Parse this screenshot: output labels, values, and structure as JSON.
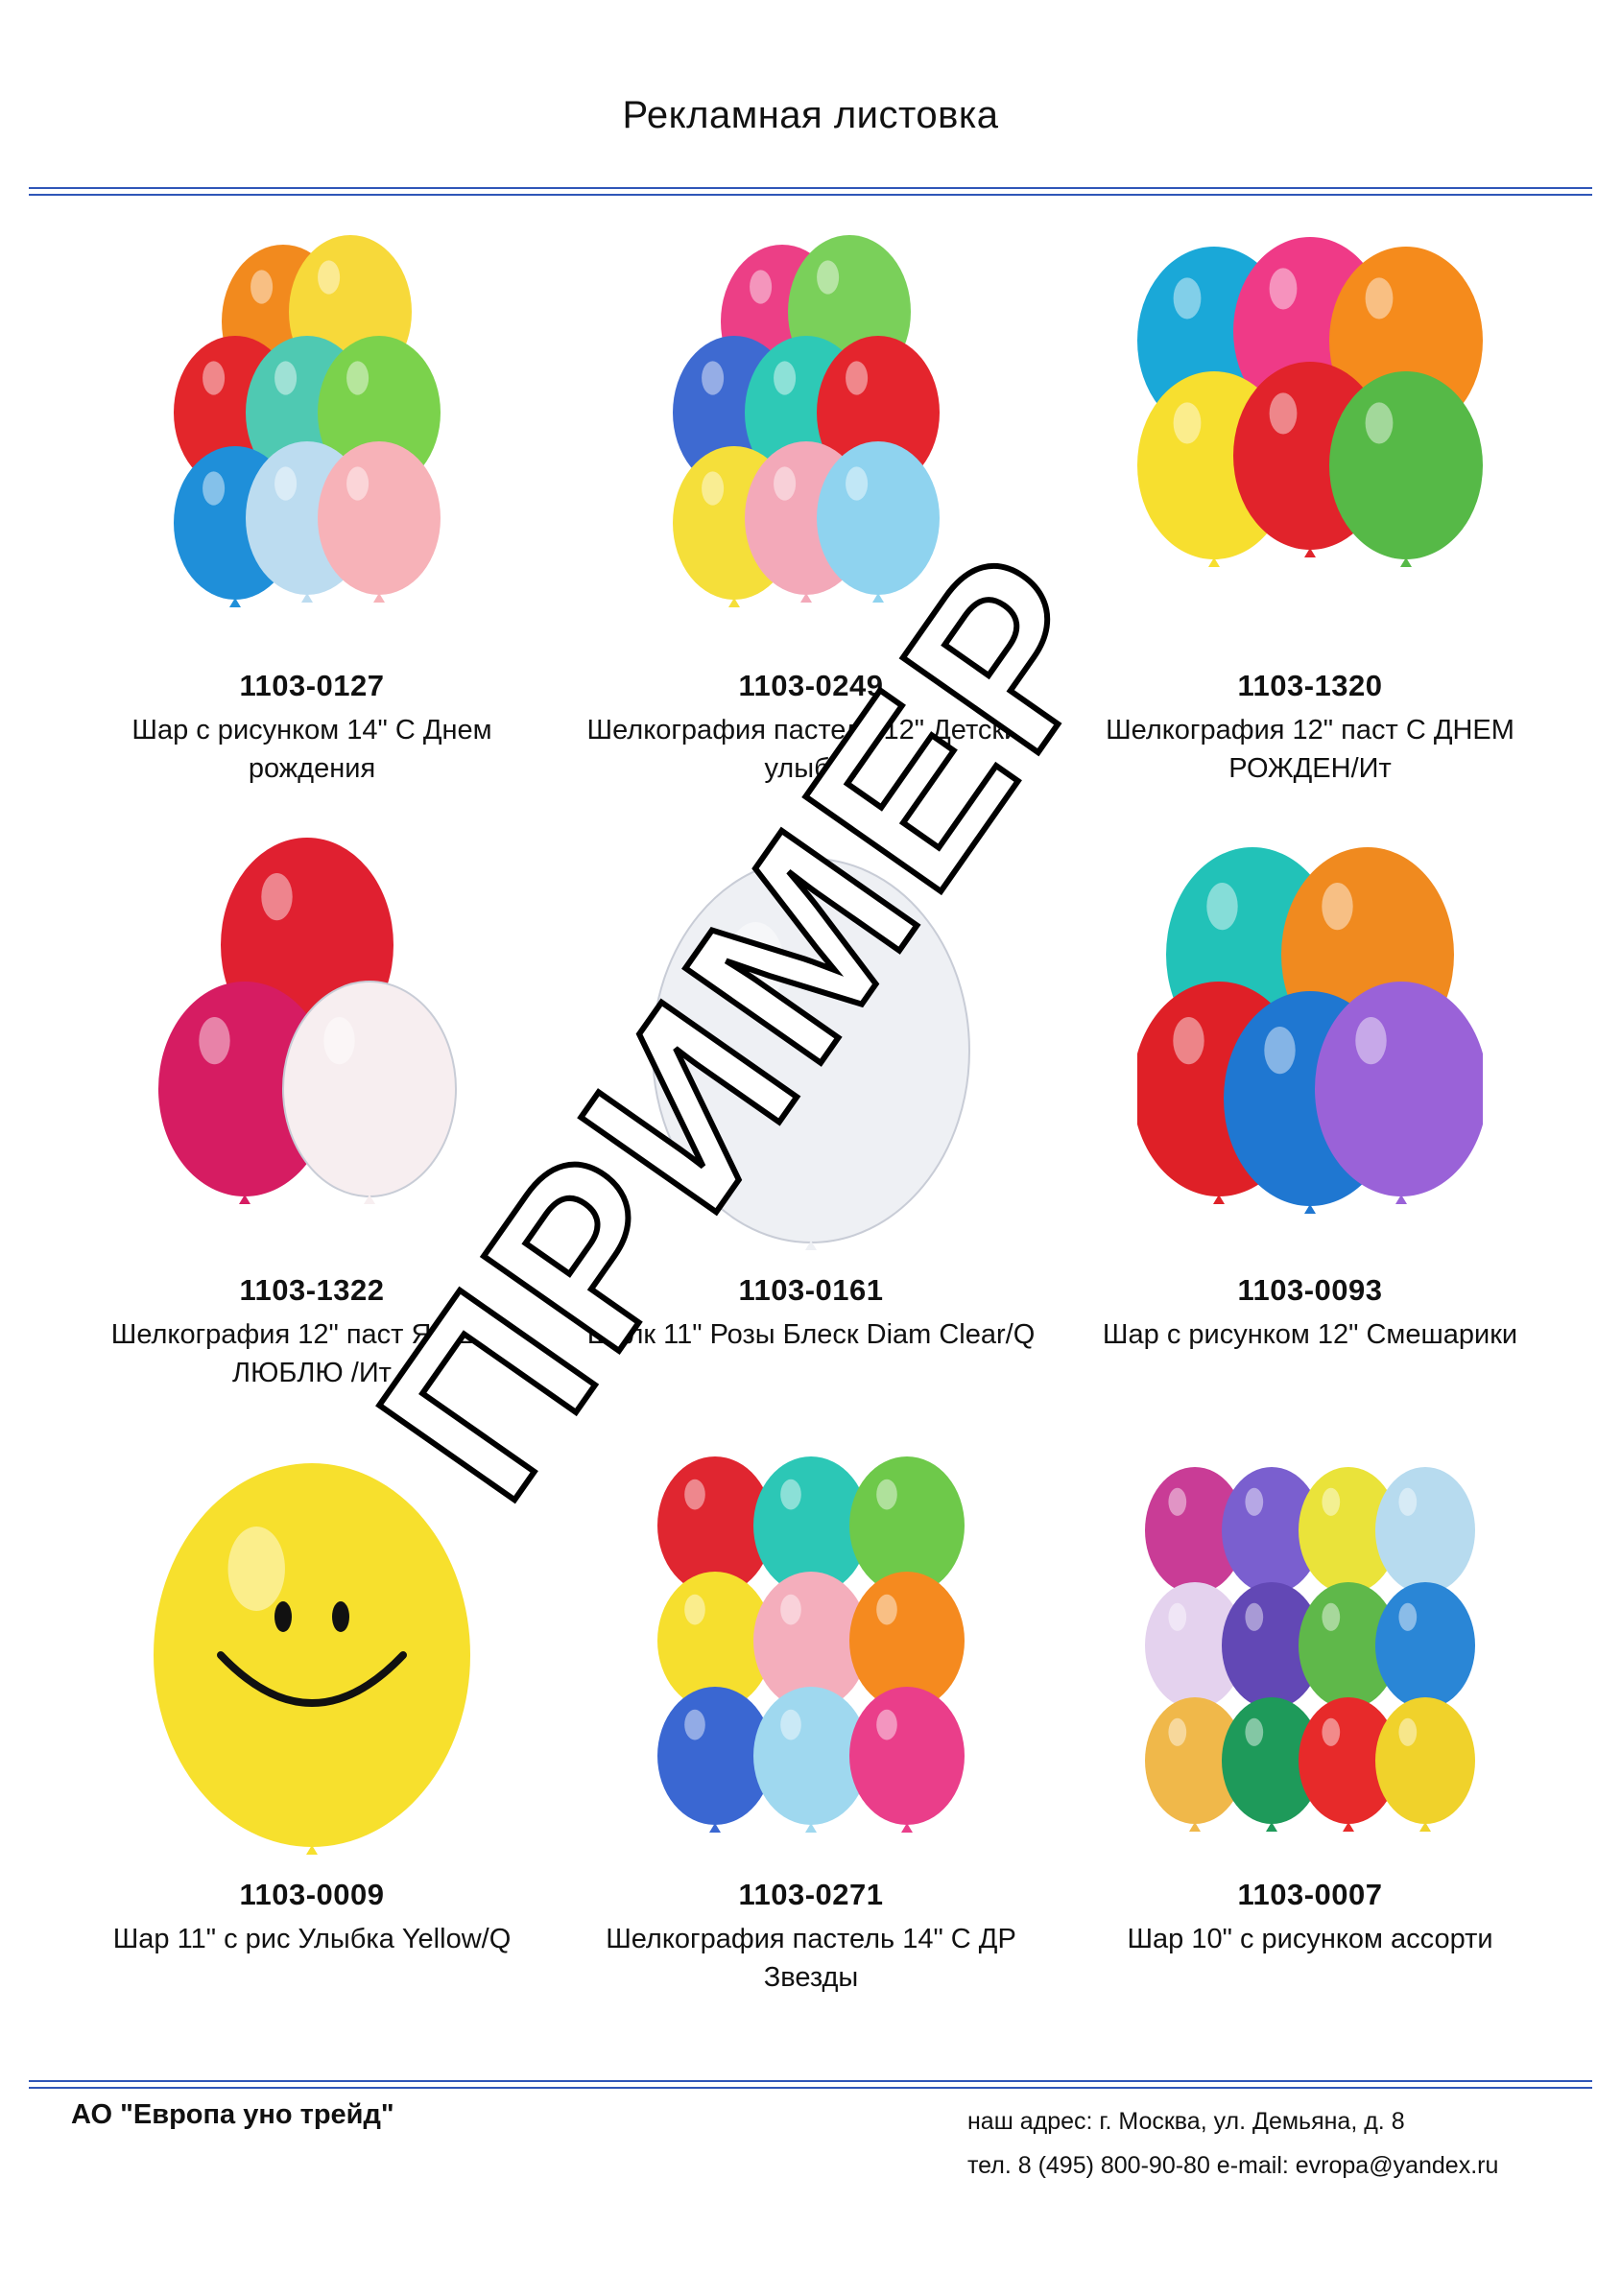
{
  "header": {
    "title": "Рекламная листовка"
  },
  "products": [
    {
      "sku": "1103-0127",
      "name": "Шар с рисунком 14\" С Днем рождения",
      "colors": [
        "#f28a1e",
        "#f7d93a",
        "#e3262b",
        "#4fc9b2",
        "#7bd24c",
        "#1f8fd9",
        "#bcdcf0",
        "#f7b2b8"
      ]
    },
    {
      "sku": "1103-0249",
      "name": "Шелкография пастель 12\" Детские улыбки",
      "colors": [
        "#ec3f86",
        "#7ad05a",
        "#3e6ad1",
        "#2ec9b6",
        "#e4252d",
        "#f5df3a",
        "#f3a9b9",
        "#8fd3ef"
      ]
    },
    {
      "sku": "1103-1320",
      "name": "Шелкография 12\" паст С ДНЕМ РОЖДЕН/Ит",
      "colors": [
        "#1aa8d8",
        "#ef3a87",
        "#f58b1c",
        "#f7df2f",
        "#e1232b",
        "#56b947"
      ]
    },
    {
      "sku": "1103-1322",
      "name": "Шелкография 12\" паст Я ТЕБЯ ЛЮБЛЮ /Ит",
      "colors": [
        "#e02030",
        "#d61c62",
        "#f7eef0"
      ]
    },
    {
      "sku": "1103-0161",
      "name": "Шелк 11\" Розы Блеск Diam Clear/Q",
      "colors": [
        "#eef0f4"
      ]
    },
    {
      "sku": "1103-0093",
      "name": "Шар с рисунком 12\" Смешарики",
      "colors": [
        "#22c2b8",
        "#f08a1f",
        "#df2027",
        "#1f77d1",
        "#9a62d8"
      ]
    },
    {
      "sku": "1103-0009",
      "name": "Шар 11\" с рис Улыбка Yellow/Q",
      "colors": [
        "#f7e02d"
      ]
    },
    {
      "sku": "1103-0271",
      "name": "Шелкография пастель 14\" С ДР Звезды",
      "colors": [
        "#e02630",
        "#2cc7b6",
        "#6ec94a",
        "#f6df2e",
        "#f4aebc",
        "#f58a1f",
        "#3a67d2",
        "#9fd8ef",
        "#ea3e8a"
      ]
    },
    {
      "sku": "1103-0007",
      "name": "Шар 10\" с рисунком ассорти",
      "colors": [
        "#c93c96",
        "#7a5fcf",
        "#eae33a",
        "#b7dbef",
        "#e4d2ee",
        "#6248b5",
        "#5fb84a",
        "#2a86d6",
        "#f0b84a",
        "#1e9a5a",
        "#e72a2a",
        "#f0d22b"
      ]
    }
  ],
  "footer": {
    "company": "АО \"Европа уно трейд\"",
    "address": "наш адрес: г. Москва, ул. Демьяна, д. 8",
    "contacts": "тел. 8 (495) 800-90-80 e-mail: evropa@yandex.ru"
  },
  "watermark": "ПРИМЕР"
}
